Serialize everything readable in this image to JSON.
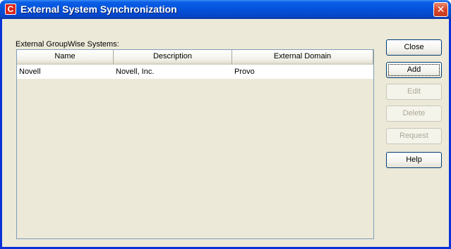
{
  "window": {
    "title": "External System Synchronization",
    "app_icon_glyph": "C",
    "close_glyph": "✕"
  },
  "list": {
    "label": "External GroupWise Systems:",
    "columns": [
      "Name",
      "Description",
      "External Domain"
    ],
    "rows": [
      [
        "Novell",
        "Novell, Inc.",
        "Provo"
      ]
    ]
  },
  "buttons": {
    "close": "Close",
    "add": "Add",
    "edit": "Edit",
    "delete": "Delete",
    "request": "Request",
    "help": "Help"
  },
  "icons": {
    "app": "novell-c-icon",
    "close": "close-icon"
  },
  "colors": {
    "titlebar": "#0551da",
    "window_bg": "#ece9d8",
    "close_button": "#d8462a",
    "app_icon": "#d8261b"
  }
}
